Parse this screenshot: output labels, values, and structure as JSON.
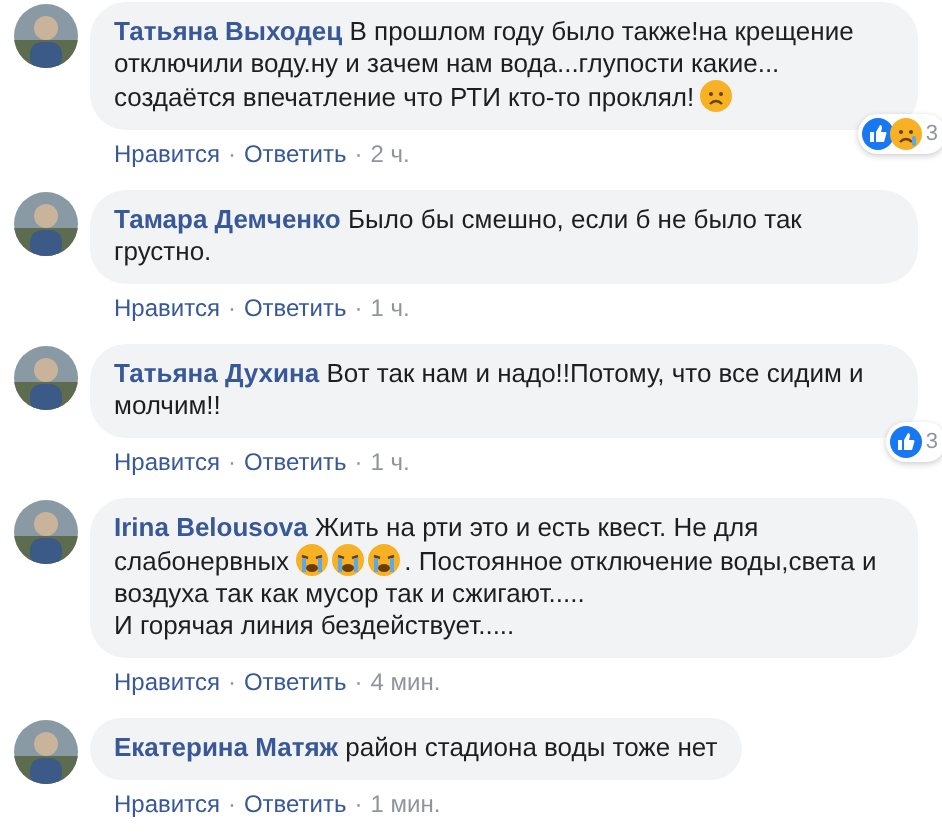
{
  "comments": [
    {
      "author": "Татьяна Выходец",
      "body": [
        {
          "kind": "text",
          "text": "В прошлом году было также!на крещение отключили воду.ну и зачем нам вода...глупости какие... создаётся впечатление что РТИ кто-то проклял!"
        },
        {
          "kind": "sad_face"
        }
      ],
      "reactions": {
        "icons": [
          {
            "kind": "like"
          },
          {
            "kind": "sad"
          }
        ],
        "count": "3"
      },
      "meta": [
        {
          "kind": "link",
          "text": "Нравится"
        },
        {
          "kind": "separator",
          "text": "·"
        },
        {
          "kind": "link",
          "text": "Ответить"
        },
        {
          "kind": "separator",
          "text": "·"
        },
        {
          "kind": "time",
          "text": "2 ч."
        }
      ]
    },
    {
      "author": "Тамара Демченко",
      "body": [
        {
          "kind": "text",
          "text": "Было бы смешно, если б не было так грустно."
        }
      ],
      "meta": [
        {
          "kind": "link",
          "text": "Нравится"
        },
        {
          "kind": "separator",
          "text": "·"
        },
        {
          "kind": "link",
          "text": "Ответить"
        },
        {
          "kind": "separator",
          "text": "·"
        },
        {
          "kind": "time",
          "text": "1 ч."
        }
      ]
    },
    {
      "author": "Татьяна Духина",
      "body": [
        {
          "kind": "text",
          "text": "Вот так нам и надо!!Потому, что все сидим и молчим!!"
        }
      ],
      "reactions": {
        "icons": [
          {
            "kind": "like"
          }
        ],
        "count": "3"
      },
      "meta": [
        {
          "kind": "link",
          "text": "Нравится"
        },
        {
          "kind": "separator",
          "text": "·"
        },
        {
          "kind": "link",
          "text": "Ответить"
        },
        {
          "kind": "separator",
          "text": "·"
        },
        {
          "kind": "time",
          "text": "1 ч."
        }
      ]
    },
    {
      "author": "Irina Belousova",
      "body": [
        {
          "kind": "text",
          "text": "Жить на рти это и есть квест. Не для слабонервных "
        },
        {
          "kind": "crying_face"
        },
        {
          "kind": "crying_face"
        },
        {
          "kind": "crying_face"
        },
        {
          "kind": "text",
          "text": ". Постоянное отключение воды,света и воздуха так как мусор так и сжигают.....\nИ горячая линия бездействует....."
        }
      ],
      "meta": [
        {
          "kind": "link",
          "text": "Нравится"
        },
        {
          "kind": "separator",
          "text": "·"
        },
        {
          "kind": "link",
          "text": "Ответить"
        },
        {
          "kind": "separator",
          "text": "·"
        },
        {
          "kind": "time",
          "text": "4 мин."
        }
      ]
    },
    {
      "author": "Екатерина Матяж",
      "body": [
        {
          "kind": "text",
          "text": "район стадиона воды тоже нет"
        }
      ],
      "meta": [
        {
          "kind": "link",
          "text": "Нравится"
        },
        {
          "kind": "separator",
          "text": "·"
        },
        {
          "kind": "link",
          "text": "Ответить"
        },
        {
          "kind": "separator",
          "text": "·"
        },
        {
          "kind": "time",
          "text": "1 мин."
        }
      ]
    }
  ]
}
